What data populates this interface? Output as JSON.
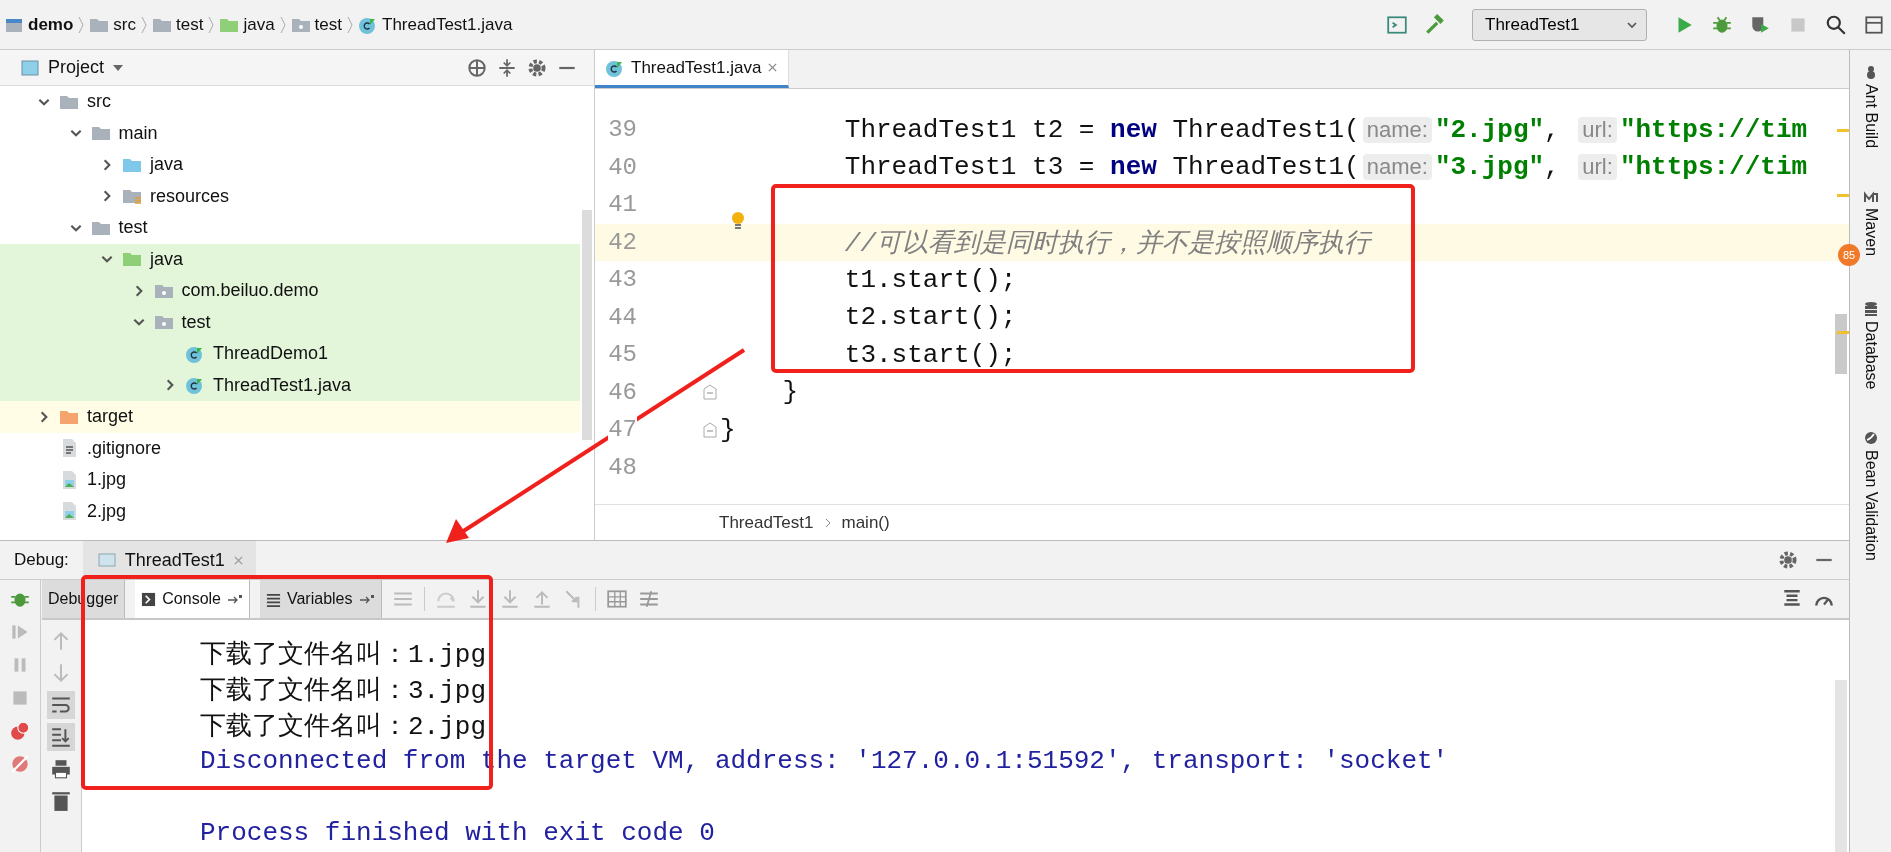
{
  "breadcrumb": [
    {
      "label": "demo",
      "kind": "module"
    },
    {
      "label": "src",
      "kind": "folder"
    },
    {
      "label": "test",
      "kind": "folder"
    },
    {
      "label": "java",
      "kind": "test-folder"
    },
    {
      "label": "test",
      "kind": "package"
    },
    {
      "label": "ThreadTest1.java",
      "kind": "class"
    }
  ],
  "run_config": {
    "label": "ThreadTest1"
  },
  "project": {
    "title": "Project",
    "tree": [
      {
        "label": "src",
        "kind": "folder",
        "expanded": true,
        "children": [
          {
            "label": "main",
            "kind": "folder",
            "expanded": true,
            "children": [
              {
                "label": "java",
                "kind": "source-folder",
                "expanded": false
              },
              {
                "label": "resources",
                "kind": "resource-folder",
                "expanded": false
              }
            ]
          },
          {
            "label": "test",
            "kind": "folder",
            "expanded": true,
            "children": [
              {
                "label": "java",
                "kind": "test-folder",
                "expanded": true,
                "color": "#e4f6da",
                "children": [
                  {
                    "label": "com.beiluo.demo",
                    "kind": "package",
                    "expanded": false,
                    "color": "#e4f6da"
                  },
                  {
                    "label": "test",
                    "kind": "package",
                    "expanded": true,
                    "color": "#e4f6da",
                    "children": [
                      {
                        "label": "ThreadDemo1",
                        "kind": "class",
                        "color": "#e4f6da"
                      },
                      {
                        "label": "ThreadTest1.java",
                        "kind": "class",
                        "expanded": false,
                        "color": "#e4f6da"
                      }
                    ]
                  }
                ]
              }
            ]
          }
        ]
      },
      {
        "label": "target",
        "kind": "excluded-folder",
        "expanded": false,
        "color": "#fffde5"
      },
      {
        "label": ".gitignore",
        "kind": "file"
      },
      {
        "label": "1.jpg",
        "kind": "image"
      },
      {
        "label": "2.jpg",
        "kind": "image"
      }
    ]
  },
  "editor": {
    "tabs": [
      {
        "label": "ThreadTest1.java",
        "selected": true
      }
    ],
    "lines": [
      {
        "number": "39",
        "kind": "statement",
        "current": false,
        "bulb": false,
        "fold": false,
        "tokens": [
          {
            "text": "ThreadTest1 t2 = ",
            "kind": "plain"
          },
          {
            "text": "new",
            "kind": "keyword"
          },
          {
            "text": " ThreadTest1(",
            "kind": "plain"
          },
          {
            "text": "name:",
            "kind": "hint"
          },
          {
            "text": "\"2.jpg\"",
            "kind": "string"
          },
          {
            "text": ", ",
            "kind": "plain"
          },
          {
            "text": "url:",
            "kind": "hint"
          },
          {
            "text": "\"https://tim",
            "kind": "string"
          }
        ]
      },
      {
        "number": "40",
        "kind": "statement",
        "current": false,
        "bulb": false,
        "fold": false,
        "tokens": [
          {
            "text": "ThreadTest1 t3 = ",
            "kind": "plain"
          },
          {
            "text": "new",
            "kind": "keyword"
          },
          {
            "text": " ThreadTest1(",
            "kind": "plain"
          },
          {
            "text": "name:",
            "kind": "hint"
          },
          {
            "text": "\"3.jpg\"",
            "kind": "string"
          },
          {
            "text": ", ",
            "kind": "plain"
          },
          {
            "text": "url:",
            "kind": "hint"
          },
          {
            "text": "\"https://tim",
            "kind": "string"
          }
        ]
      },
      {
        "number": "41",
        "kind": "blank",
        "current": false,
        "bulb": false,
        "fold": false
      },
      {
        "number": "42",
        "kind": "statement",
        "current": true,
        "bulb": true,
        "fold": false,
        "tokens": [
          {
            "text": "//可以看到是同时执行，并不是按照顺序执行",
            "kind": "comment"
          }
        ]
      },
      {
        "number": "43",
        "kind": "statement",
        "current": false,
        "bulb": false,
        "fold": false,
        "tokens": [
          {
            "text": "t1.start();",
            "kind": "plain"
          }
        ]
      },
      {
        "number": "44",
        "kind": "statement",
        "current": false,
        "bulb": false,
        "fold": false,
        "tokens": [
          {
            "text": "t2.start();",
            "kind": "plain"
          }
        ]
      },
      {
        "number": "45",
        "kind": "statement",
        "current": false,
        "bulb": false,
        "fold": false,
        "tokens": [
          {
            "text": "t3.start();",
            "kind": "plain"
          }
        ]
      },
      {
        "number": "46",
        "kind": "block-end",
        "current": false,
        "bulb": false,
        "fold": true,
        "tokens": [
          {
            "text": "}",
            "kind": "plain"
          }
        ]
      },
      {
        "number": "47",
        "kind": "class-end",
        "current": false,
        "bulb": false,
        "fold": true,
        "tokens": [
          {
            "text": "}",
            "kind": "plain"
          }
        ]
      },
      {
        "number": "48",
        "kind": "blank",
        "current": false,
        "bulb": false,
        "fold": false
      }
    ],
    "breadcrumb": [
      "ThreadTest1",
      "main()"
    ]
  },
  "tool_windows": [
    {
      "label": "Ant Build",
      "kind": "ant"
    },
    {
      "label": "Maven",
      "kind": "maven"
    },
    {
      "label": "Database",
      "kind": "database"
    },
    {
      "label": "Bean Validation",
      "kind": "bean"
    }
  ],
  "badge": "85",
  "debug": {
    "title": "Debug:",
    "session": "ThreadTest1",
    "tabs": [
      {
        "label": "Debugger",
        "selected": false
      },
      {
        "label": "Console",
        "selected": true
      },
      {
        "label": "Variables",
        "selected": false
      }
    ],
    "side_tools": [
      {
        "kind": "up",
        "on": false
      },
      {
        "kind": "down",
        "on": false
      },
      {
        "kind": "wrap",
        "on": true
      },
      {
        "kind": "scroll-end",
        "on": true
      },
      {
        "kind": "print",
        "on": false
      },
      {
        "kind": "trash",
        "on": false
      }
    ],
    "console": [
      {
        "text": "下载了文件名叫：1.jpg",
        "kind": "output"
      },
      {
        "text": "下载了文件名叫：3.jpg",
        "kind": "output"
      },
      {
        "text": "下载了文件名叫：2.jpg",
        "kind": "output"
      },
      {
        "text": "Disconnected from the target VM, address: '127.0.0.1:51592', transport: 'socket'",
        "kind": "system"
      },
      {
        "kind": "blank"
      },
      {
        "text": "Process finished with exit code 0",
        "kind": "system"
      }
    ]
  }
}
